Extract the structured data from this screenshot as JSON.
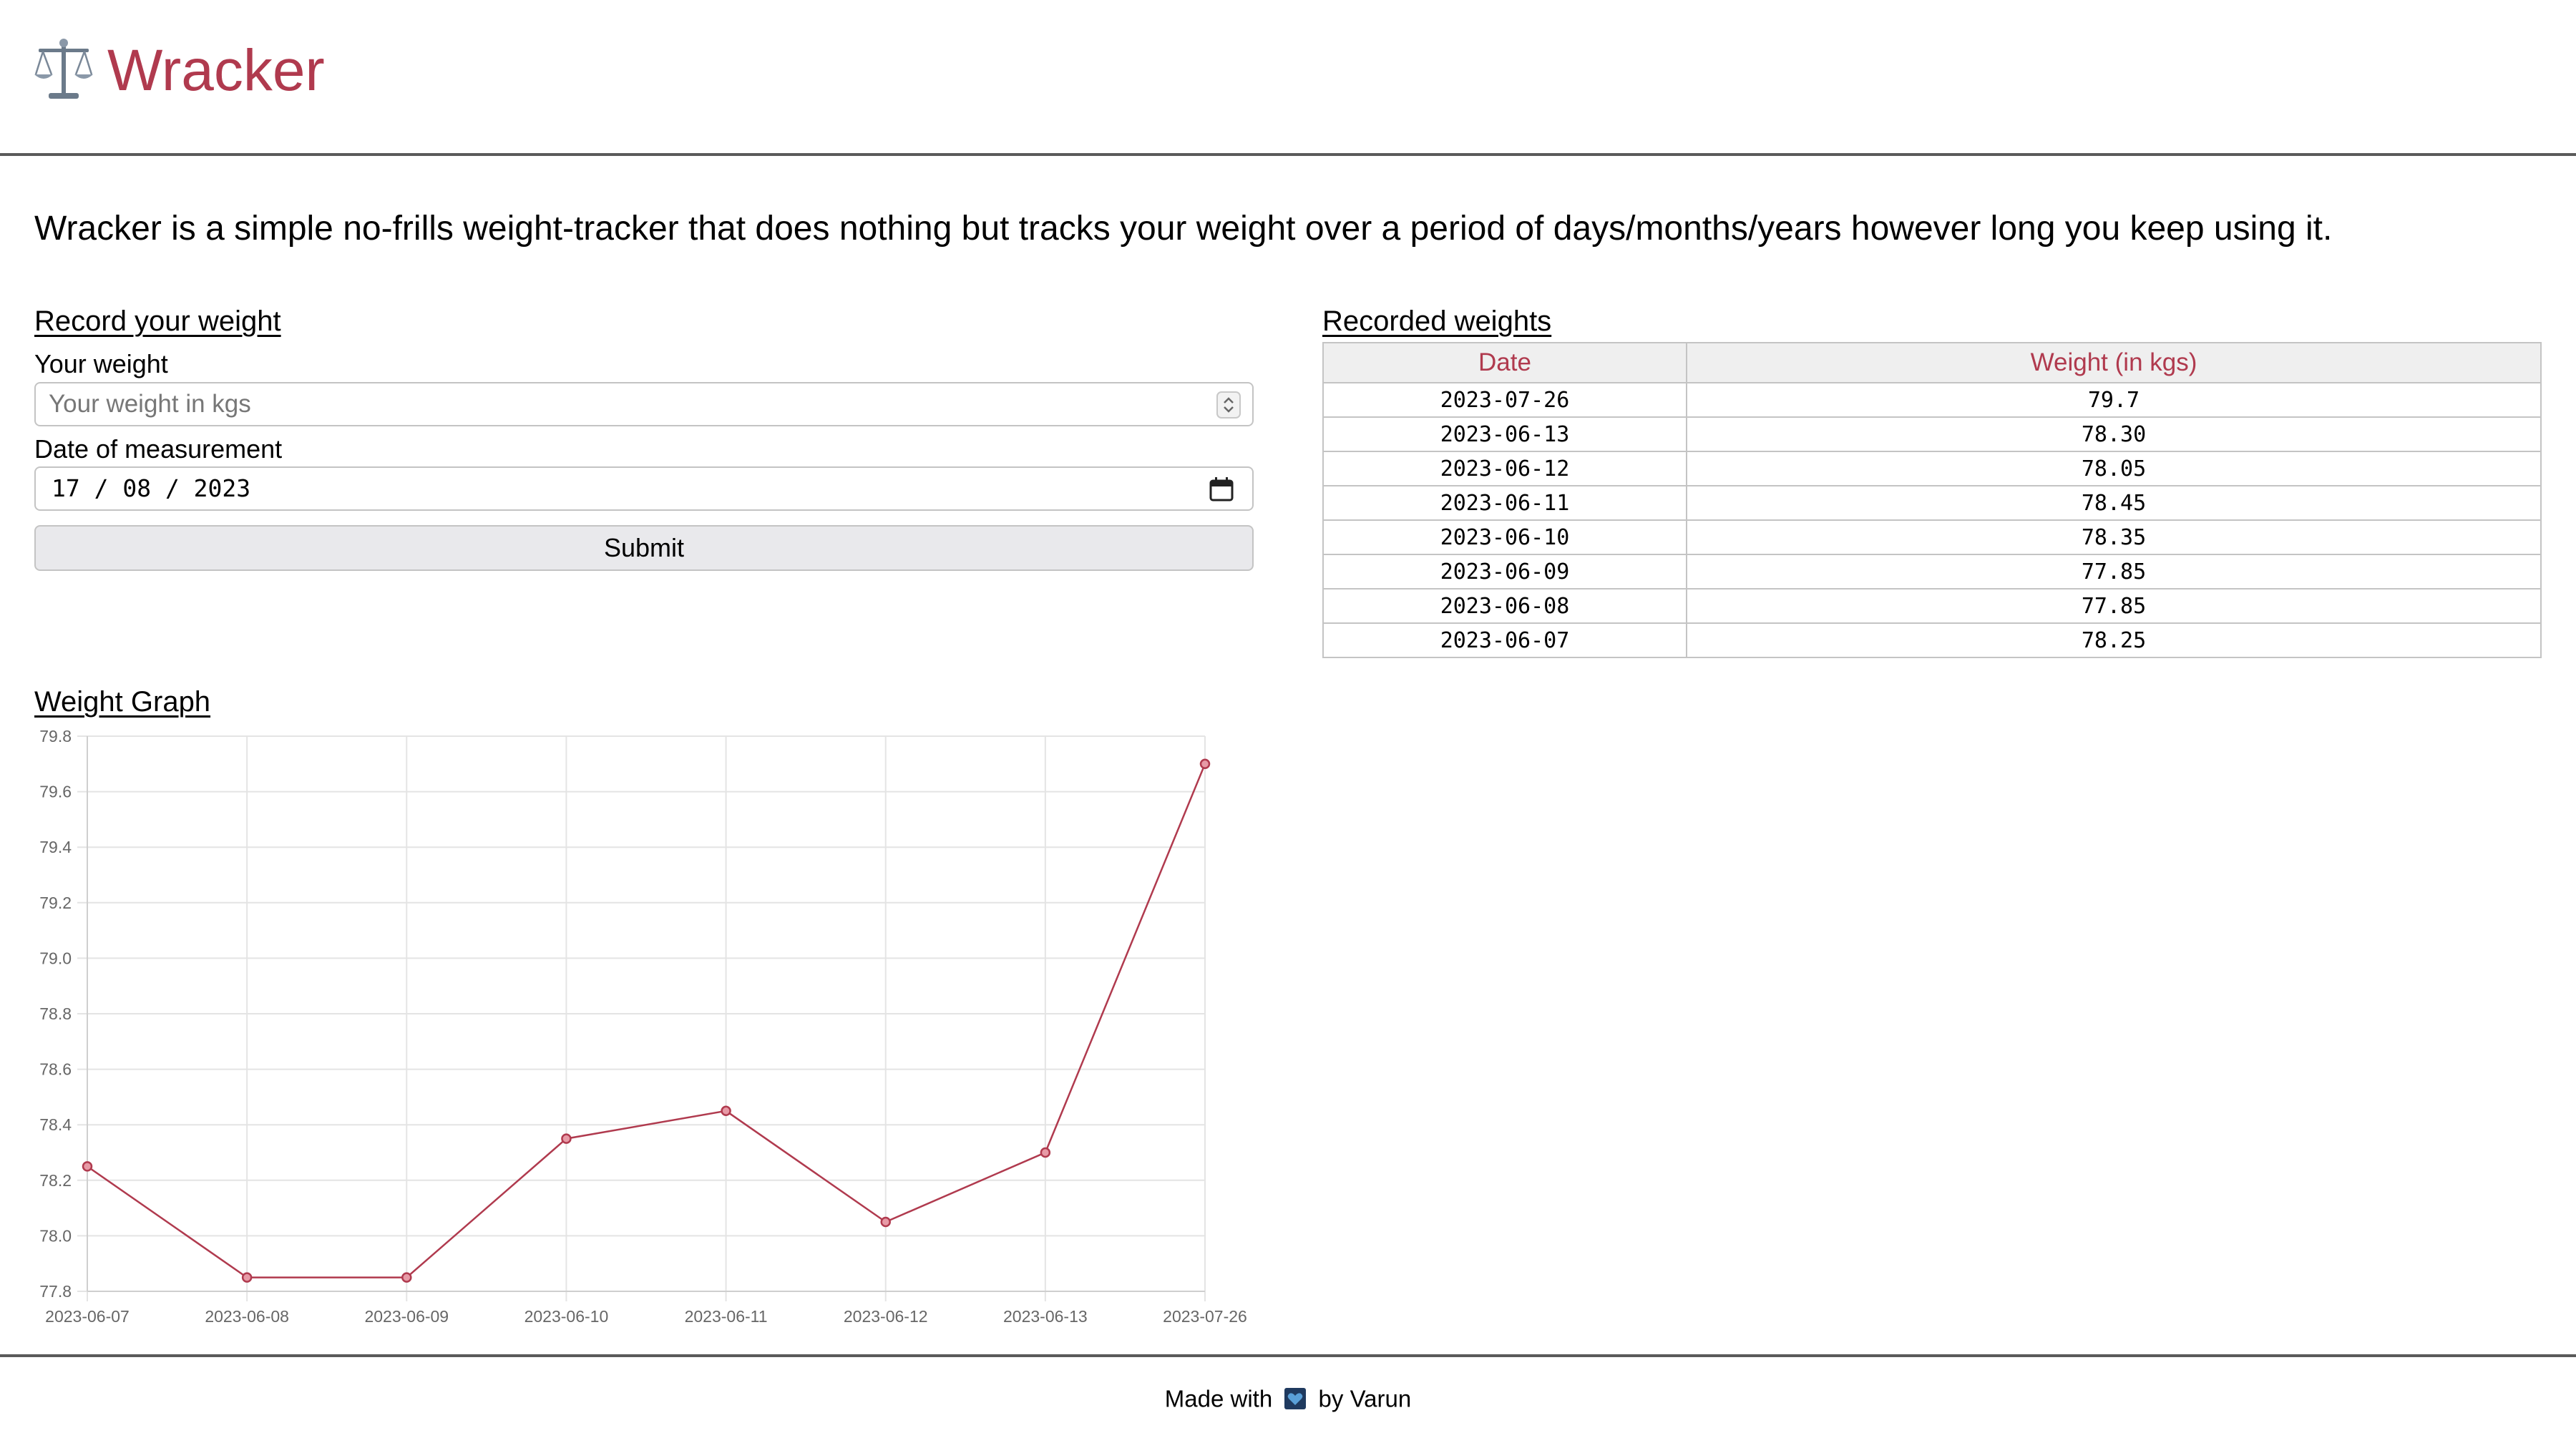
{
  "header": {
    "logo_icon": "balance-scale-icon",
    "title": "Wracker",
    "accent_color": "#b03a4e"
  },
  "intro": "Wracker is a simple no-frills weight-tracker that does nothing but tracks your weight over a period of days/months/years however long you keep using it.",
  "record_form": {
    "heading": "Record your weight",
    "weight_label": "Your weight",
    "weight_placeholder": "Your weight in kgs",
    "weight_value": "",
    "date_label": "Date of measurement",
    "date_value": "17 / 08 / 2023",
    "submit_label": "Submit"
  },
  "recorded": {
    "heading": "Recorded weights",
    "columns": [
      "Date",
      "Weight (in kgs)"
    ],
    "rows": [
      [
        "2023-07-26",
        "79.7"
      ],
      [
        "2023-06-13",
        "78.30"
      ],
      [
        "2023-06-12",
        "78.05"
      ],
      [
        "2023-06-11",
        "78.45"
      ],
      [
        "2023-06-10",
        "78.35"
      ],
      [
        "2023-06-09",
        "77.85"
      ],
      [
        "2023-06-08",
        "77.85"
      ],
      [
        "2023-06-07",
        "78.25"
      ]
    ]
  },
  "graph": {
    "heading": "Weight Graph"
  },
  "chart_data": {
    "type": "line",
    "title": "",
    "xlabel": "",
    "ylabel": "",
    "categories": [
      "2023-06-07",
      "2023-06-08",
      "2023-06-09",
      "2023-06-10",
      "2023-06-11",
      "2023-06-12",
      "2023-06-13",
      "2023-07-26"
    ],
    "series": [
      {
        "values": [
          78.25,
          77.85,
          77.85,
          78.35,
          78.45,
          78.05,
          78.3,
          79.7
        ]
      }
    ],
    "ylim": [
      77.8,
      79.8
    ],
    "yticks": [
      "77.8",
      "78.0",
      "78.2",
      "78.4",
      "78.6",
      "78.8",
      "79.0",
      "79.2",
      "79.4",
      "79.6",
      "79.8"
    ],
    "grid": true,
    "legend": "none",
    "line_color": "#b03a4e"
  },
  "footer": {
    "prefix": "Made with",
    "icon": "heart-icon",
    "suffix": "by Varun"
  }
}
